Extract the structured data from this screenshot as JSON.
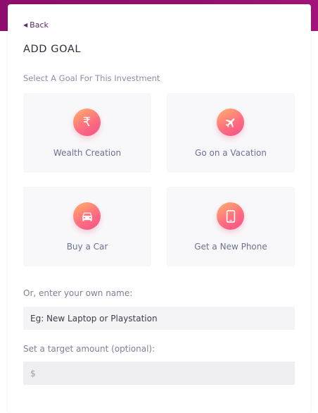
{
  "back_label": "Back",
  "title": "ADD GOAL",
  "subtitle": "Select A Goal For This Investment",
  "goals": [
    {
      "label": "Wealth Creation",
      "icon": "rupee-icon"
    },
    {
      "label": "Go on a Vacation",
      "icon": "airplane-icon"
    },
    {
      "label": "Buy a Car",
      "icon": "car-icon"
    },
    {
      "label": "Get a New Phone",
      "icon": "phone-icon"
    }
  ],
  "own_name": {
    "label": "Or, enter your own name:",
    "placeholder": "Eg: New Laptop or Playstation"
  },
  "target": {
    "label": "Set a target amount (optional):",
    "placeholder": "$"
  },
  "colors": {
    "header": "#8e0c6b",
    "accent_start": "#ffb36b",
    "accent_end": "#f14f8a"
  }
}
